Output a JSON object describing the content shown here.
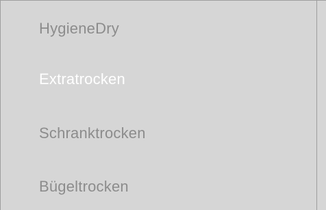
{
  "menu": {
    "items": [
      {
        "label": "HygieneDry",
        "selected": false
      },
      {
        "label": "Extratrocken",
        "selected": true
      },
      {
        "label": "Schranktrocken",
        "selected": false
      },
      {
        "label": "Bügeltrocken",
        "selected": false
      }
    ]
  },
  "colors": {
    "background": "#d6d6d6",
    "frame": "#9e9e9e",
    "item_text": "#8c8c8c",
    "selected_text": "#ffffff"
  }
}
